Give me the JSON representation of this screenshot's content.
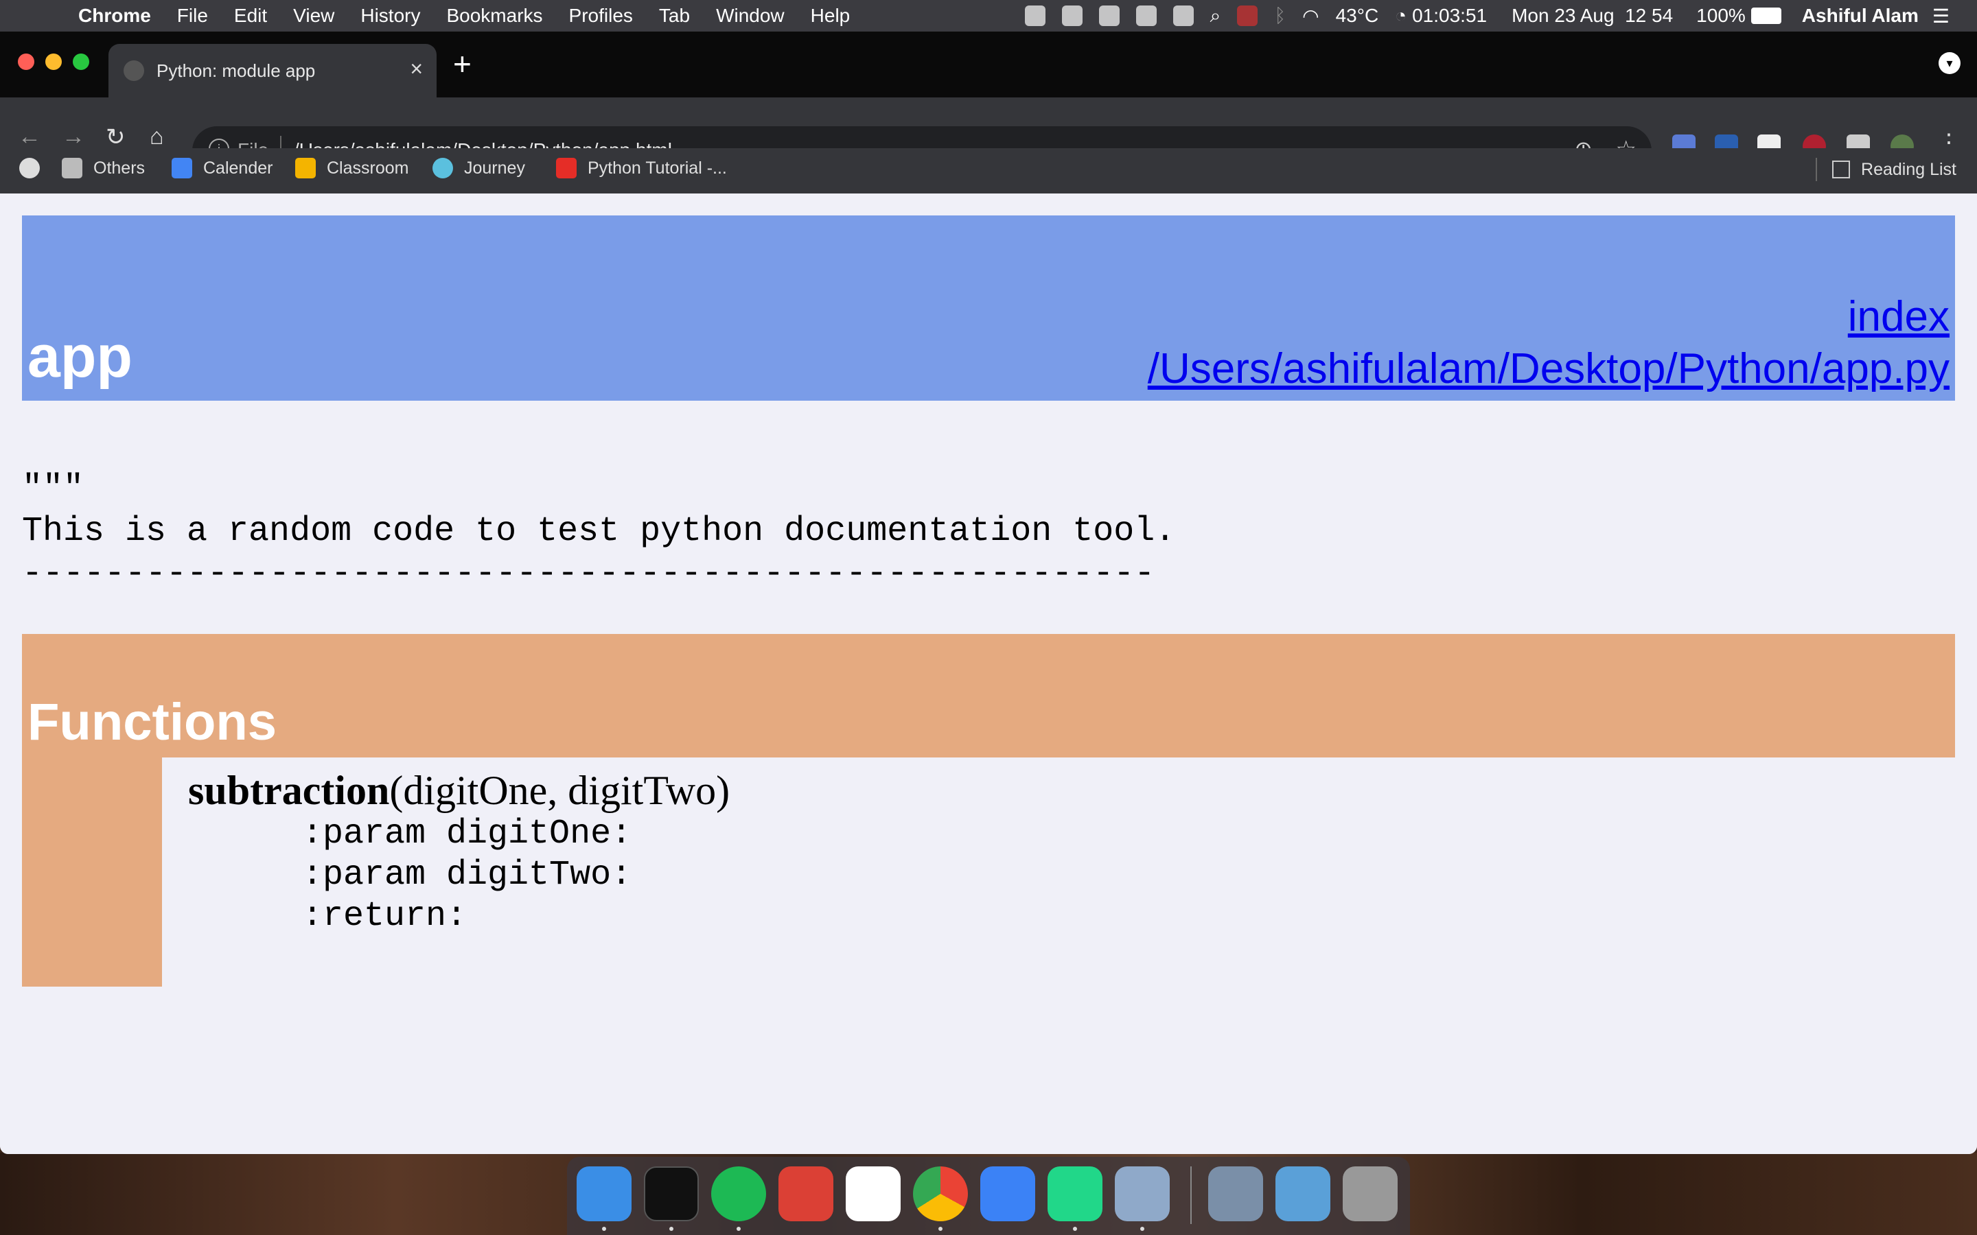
{
  "menubar": {
    "app": "Chrome",
    "items": [
      "File",
      "Edit",
      "View",
      "History",
      "Bookmarks",
      "Profiles",
      "Tab",
      "Window",
      "Help"
    ],
    "temperature": "43°C",
    "timer": "01:03:51",
    "datetime": "Mon 23 Aug  12 54",
    "battery": "100%",
    "user": "Ashiful Alam"
  },
  "tab": {
    "title": "Python: module app"
  },
  "address": {
    "scheme": "File",
    "url": "/Users/ashifulalam/Desktop/Python/app.html"
  },
  "bookmarks": {
    "items": [
      "Others",
      "Calender",
      "Classroom",
      "Journey",
      "Python Tutorial -..."
    ],
    "reading_list": "Reading List"
  },
  "page": {
    "module_name": "app",
    "index_link": "index",
    "source_link": "/Users/ashifulalam/Desktop/Python/app.py",
    "docstring": "\"\"\"\nThis is a random code to test python documentation tool.\n-------------------------------------------------------",
    "functions_heading": "Functions",
    "func_name": "subtraction",
    "func_args": "(digitOne, digitTwo)",
    "func_doc": ":param digitOne:\n:param digitTwo:\n:return:"
  },
  "colors": {
    "heading_bg": "#7a9ce8",
    "functions_bg": "#e5aa80",
    "link": "#0000ee"
  }
}
